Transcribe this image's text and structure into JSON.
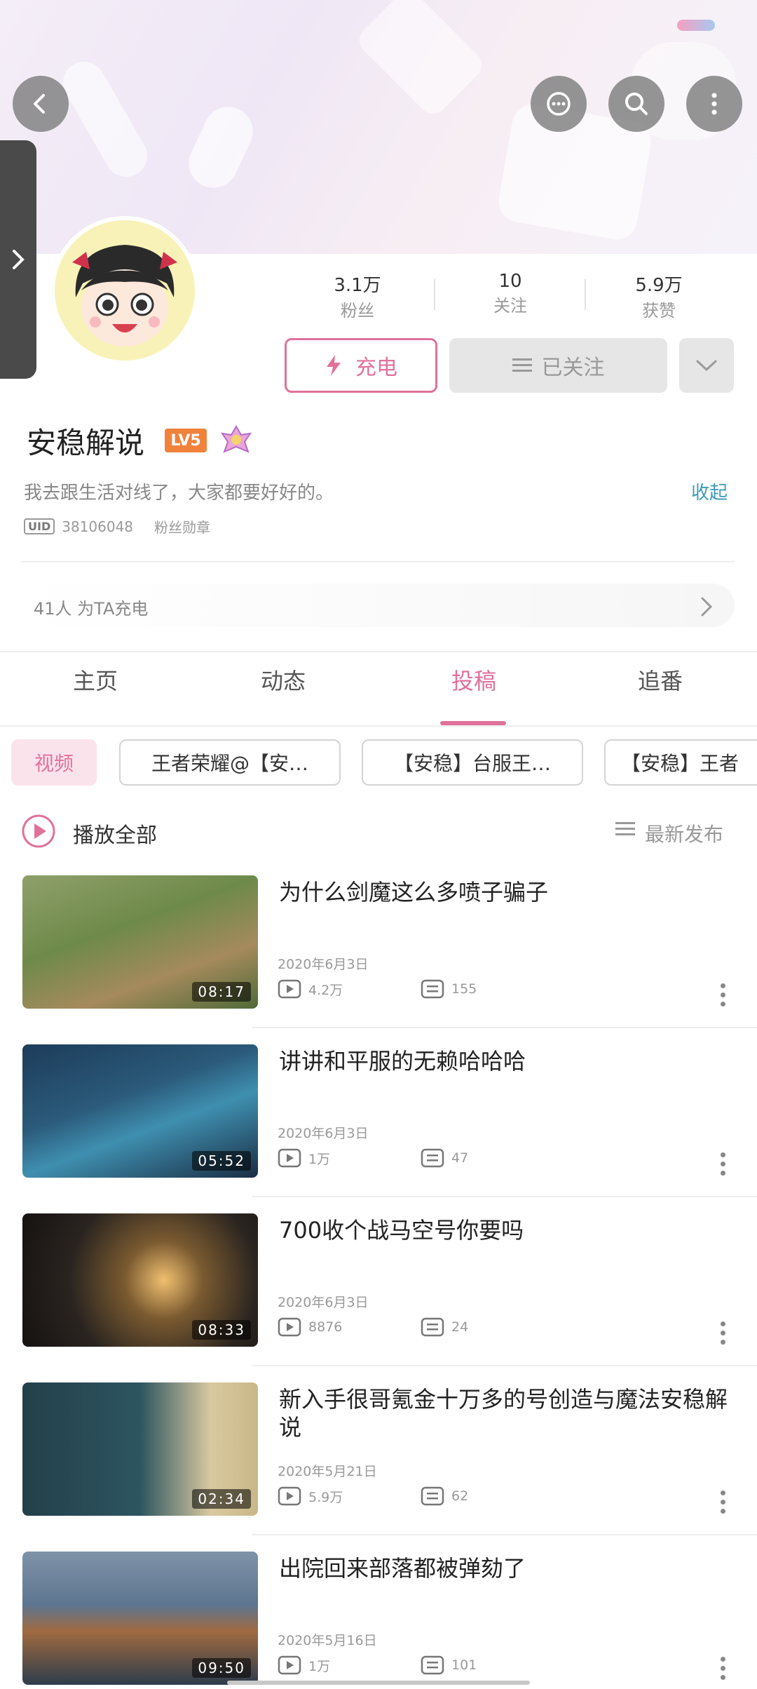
{
  "header": {
    "back_icon": "back-icon",
    "message_icon": "message-icon",
    "search_icon": "search-icon",
    "more_icon": "more-vertical-icon"
  },
  "profile": {
    "name": "安稳解说",
    "level": "LV5",
    "signature": "我去跟生活对线了，大家都要好好的。",
    "collapse_label": "收起",
    "uid_tag": "UID",
    "uid": "38106048",
    "fan_badge": "粉丝勋章",
    "stats": [
      {
        "value": "3.1万",
        "label": "粉丝"
      },
      {
        "value": "10",
        "label": "关注"
      },
      {
        "value": "5.9万",
        "label": "获赞"
      }
    ],
    "charge_button": "充电",
    "followed_button": "已关注",
    "charge_count_text": "41人 为TA充电"
  },
  "tabs": [
    {
      "label": "主页",
      "active": false
    },
    {
      "label": "动态",
      "active": false
    },
    {
      "label": "投稿",
      "active": true
    },
    {
      "label": "追番",
      "active": false
    }
  ],
  "filter_chips": [
    "视频",
    "王者荣耀@【安…",
    "【安稳】台服王…",
    "【安稳】王者"
  ],
  "list_header": {
    "play_all": "播放全部",
    "sort": "最新发布"
  },
  "videos": [
    {
      "title": "为什么剑魔这么多喷子骗子",
      "date": "2020年6月3日",
      "views": "4.2万",
      "comments": "155",
      "duration": "08:17"
    },
    {
      "title": "讲讲和平服的无赖哈哈哈",
      "date": "2020年6月3日",
      "views": "1万",
      "comments": "47",
      "duration": "05:52"
    },
    {
      "title": "700收个战马空号你要吗",
      "date": "2020年6月3日",
      "views": "8876",
      "comments": "24",
      "duration": "08:33"
    },
    {
      "title": "新入手很哥氪金十万多的号创造与魔法安稳解说",
      "date": "2020年5月21日",
      "views": "5.9万",
      "comments": "62",
      "duration": "02:34"
    },
    {
      "title": "出院回来部落都被弹劾了",
      "date": "2020年5月16日",
      "views": "1万",
      "comments": "101",
      "duration": "09:50"
    }
  ],
  "colors": {
    "accent": "#e0729a",
    "link": "#3d9ab9",
    "level_badge": "#f0823c"
  }
}
